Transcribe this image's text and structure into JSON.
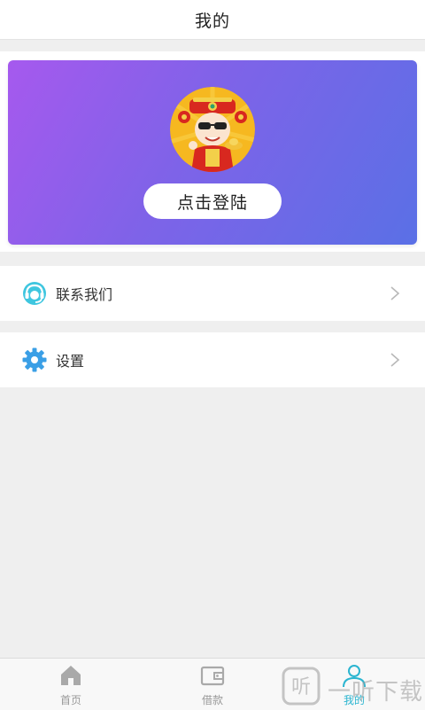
{
  "header": {
    "title": "我的"
  },
  "profile": {
    "login_label": "点击登陆",
    "avatar_icon": "fortune-god-avatar"
  },
  "menu": [
    {
      "label": "联系我们",
      "icon": "customer-service-icon"
    },
    {
      "label": "设置",
      "icon": "gear-icon"
    }
  ],
  "tabs": [
    {
      "label": "首页",
      "icon": "home-icon",
      "active": false
    },
    {
      "label": "借款",
      "icon": "wallet-icon",
      "active": false
    },
    {
      "label": "我的",
      "icon": "user-icon",
      "active": true
    }
  ],
  "watermark": {
    "text": "一听下载",
    "logo_char": "听"
  },
  "colors": {
    "gradient_start": "#a659ee",
    "gradient_end": "#5a70e6",
    "accent": "#2bb5d0",
    "background": "#efefef"
  }
}
